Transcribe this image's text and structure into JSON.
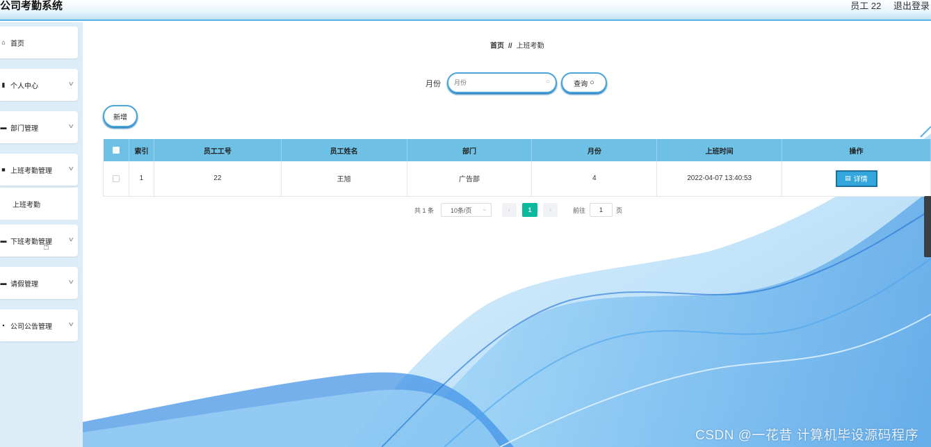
{
  "app": {
    "title": "公司考勤系统"
  },
  "topbar": {
    "user": "员工 22",
    "logout": "退出登录"
  },
  "sidebar": {
    "items": [
      {
        "label": "首页",
        "icon": "home-icon",
        "glyph": "⌂",
        "has_chevron": false
      },
      {
        "label": "个人中心",
        "icon": "user-icon",
        "glyph": "▮",
        "has_chevron": true
      },
      {
        "label": "部门管理",
        "icon": "folder-icon",
        "glyph": "▬",
        "has_chevron": true
      },
      {
        "label": "上班考勤管理",
        "icon": "camera-icon",
        "glyph": "■",
        "has_chevron": true
      },
      {
        "label": "下班考勤管理",
        "icon": "monitor-icon",
        "glyph": "▬",
        "has_chevron": true
      },
      {
        "label": "请假管理",
        "icon": "calendar-icon",
        "glyph": "▬",
        "has_chevron": true
      },
      {
        "label": "公司公告管理",
        "icon": "grid-icon",
        "glyph": "▪",
        "has_chevron": true
      }
    ],
    "submenu": {
      "label": "上班考勤"
    }
  },
  "breadcrumb": {
    "home": "首页",
    "separator": "//",
    "current": "上班考勤"
  },
  "search": {
    "label": "月份",
    "placeholder": "月份",
    "button": "查询"
  },
  "toolbar": {
    "add": "新增"
  },
  "table": {
    "columns": [
      "索引",
      "员工工号",
      "员工姓名",
      "部门",
      "月份",
      "上班时间",
      "操作"
    ],
    "rows": [
      {
        "index": "1",
        "employee_id": "22",
        "name": "王旭",
        "department": "广告部",
        "month": "4",
        "time": "2022-04-07 13:40:53",
        "action": "详情"
      }
    ]
  },
  "pagination": {
    "total": "共 1 条",
    "page_size": "10条/页",
    "current": "1",
    "goto_label": "前往",
    "goto_value": "1",
    "page_suffix": "页"
  },
  "watermark": "CSDN @一花昔 计算机毕设源码程序",
  "colors": {
    "header_accent": "#56b4e6",
    "table_header": "#6ec0e5",
    "active_page": "#0bba9c",
    "detail_button": "#33a7dc"
  }
}
